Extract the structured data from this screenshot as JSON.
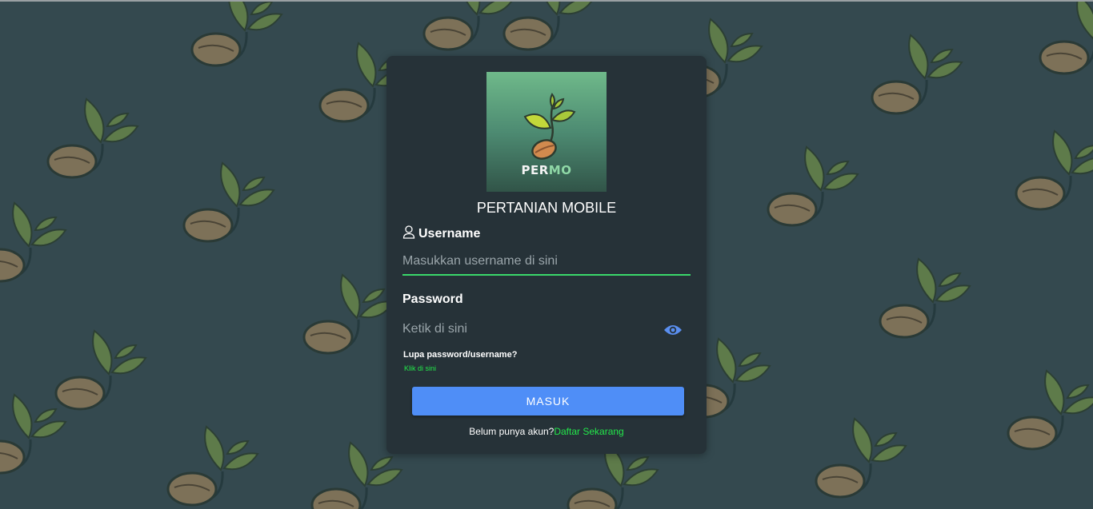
{
  "brand": {
    "logo_part1": "PER",
    "logo_part2": "MO",
    "app_title": "PERTANIAN MOBILE"
  },
  "login_form": {
    "username_label": "Username",
    "username_placeholder": "Masukkan username di sini",
    "password_label": "Password",
    "password_placeholder": "Ketik di sini",
    "forgot_text": "Lupa password/username?",
    "forgot_link": "Klik di sini",
    "submit_label": "MASUK",
    "register_prompt": "Belum punya akun?",
    "register_link": "Daftar Sekarang"
  },
  "icons": {
    "user": "user-icon",
    "eye": "eye-icon",
    "background": "sprout-bean-pattern"
  },
  "colors": {
    "page_background": "#34494f",
    "card": "#263238",
    "accent_green": "#23e64a",
    "button_blue": "#4f8ef7",
    "eye_icon": "#5a8ff0"
  }
}
